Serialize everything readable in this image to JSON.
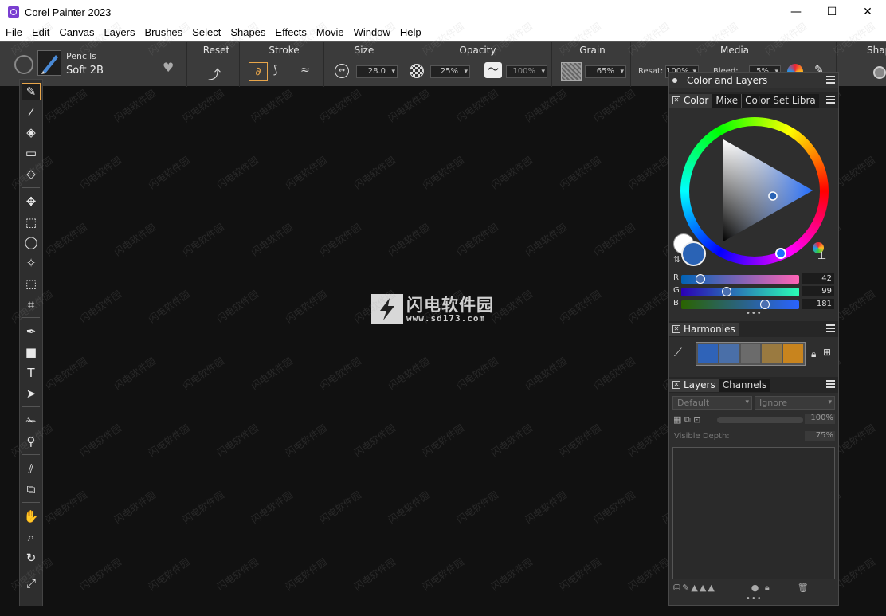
{
  "window": {
    "title": "Corel Painter 2023",
    "minimize": "—",
    "maximize": "☐",
    "close": "✕"
  },
  "menu": [
    "File",
    "Edit",
    "Canvas",
    "Layers",
    "Brushes",
    "Select",
    "Shapes",
    "Effects",
    "Movie",
    "Window",
    "Help"
  ],
  "propbar": {
    "brush_category": "Pencils",
    "brush_variant": "Soft 2B",
    "reset_label": "Reset",
    "stroke_label": "Stroke",
    "size_label": "Size",
    "size_value": "28.0",
    "opacity_label": "Opacity",
    "opacity_value": "25%",
    "opacity_value2": "100%",
    "grain_label": "Grain",
    "grain_value": "65%",
    "media_label": "Media",
    "resat_label": "Resat:",
    "resat_value": "100%",
    "bleed_label": "Bleed:",
    "bleed_value": "5%",
    "shape_label": "Shap"
  },
  "watermark": {
    "text": "闪电软件园",
    "url": "www.sd173.com",
    "tile": "闪电软件园"
  },
  "panel": {
    "group_title": "Color and Layers",
    "color_tabs": [
      "Color",
      "Mixe",
      "Color Set Libra"
    ],
    "rgb": [
      {
        "label": "R",
        "value": "42",
        "fraction": 0.165
      },
      {
        "label": "G",
        "value": "99",
        "fraction": 0.388
      },
      {
        "label": "B",
        "value": "181",
        "fraction": 0.71
      }
    ],
    "more_dots": "•••",
    "harmonies_tab": "Harmonies",
    "harmony_swatches": [
      "#2f63b8",
      "#4a6fa8",
      "#6b6b6b",
      "#9a7a40",
      "#c8841e"
    ],
    "layers_tabs": [
      "Layers",
      "Channels"
    ],
    "composite_method": "Default",
    "preserve_mode": "Ignore",
    "layer_opacity": "100%",
    "visible_depth_label": "Visible Depth:",
    "visible_depth_value": "75%"
  },
  "colors": {
    "primary": "#2a63b5",
    "secondary": "#ffffff",
    "accent": "#e9a64a"
  }
}
